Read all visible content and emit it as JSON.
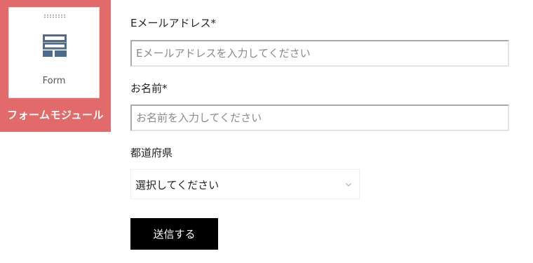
{
  "module": {
    "card_label": "Form",
    "title": "フォームモジュール",
    "icon": "form-layout-icon",
    "accent_color": "#e36a6a",
    "icon_color": "#4f6a8a"
  },
  "form": {
    "email": {
      "label": "Eメールアドレス*",
      "placeholder": "Eメールアドレスを入力してください",
      "value": ""
    },
    "name": {
      "label": "お名前*",
      "placeholder": "お名前を入力してください",
      "value": ""
    },
    "prefecture": {
      "label": "都道府県",
      "selected": "選択してください",
      "icon": "chevron-down-icon"
    },
    "submit_label": "送信する"
  }
}
